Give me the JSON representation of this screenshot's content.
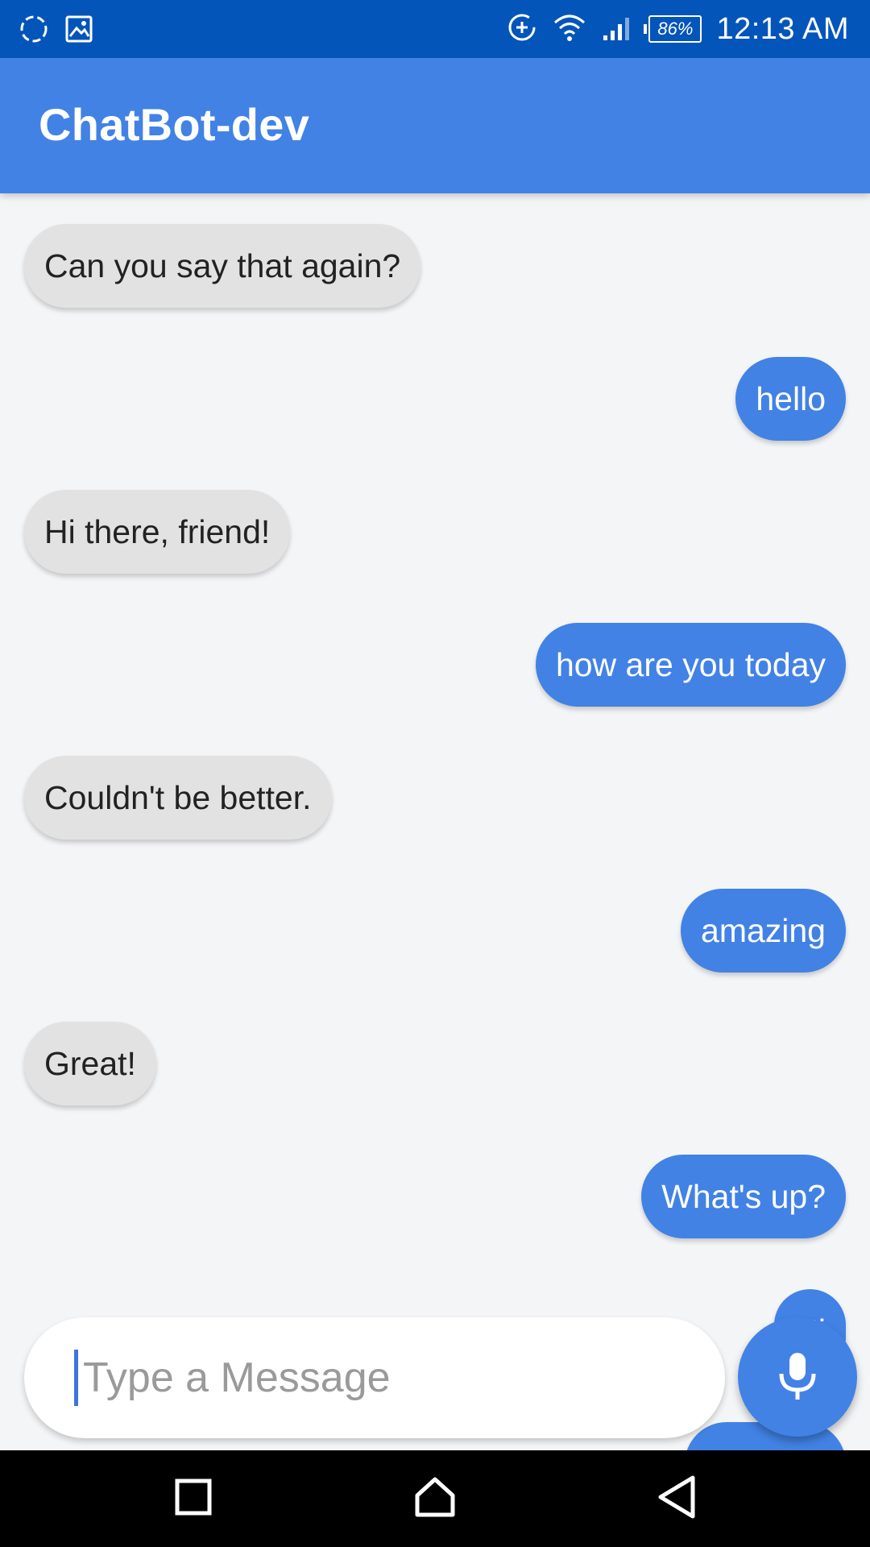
{
  "status_bar": {
    "time": "12:13 AM",
    "battery": "86%",
    "icons": [
      "sync-icon",
      "image-icon",
      "data-saver-icon",
      "wifi-icon",
      "signal-icon",
      "battery-icon"
    ]
  },
  "app_bar": {
    "title": "ChatBot-dev"
  },
  "messages": [
    {
      "sender": "bot",
      "text": "Can you say that again?"
    },
    {
      "sender": "user",
      "text": "hello"
    },
    {
      "sender": "bot",
      "text": "Hi there, friend!"
    },
    {
      "sender": "user",
      "text": "how are you today"
    },
    {
      "sender": "bot",
      "text": "Couldn't be better."
    },
    {
      "sender": "user",
      "text": "amazing"
    },
    {
      "sender": "bot",
      "text": "Great!"
    },
    {
      "sender": "user",
      "text": "What's up?"
    },
    {
      "sender": "user",
      "text": "Hi"
    }
  ],
  "composer": {
    "placeholder": "Type a Message",
    "value": "",
    "mic_icon": "mic-icon"
  },
  "nav_bar": {
    "icons": [
      "recents-icon",
      "home-icon",
      "back-icon"
    ]
  },
  "colors": {
    "status_bar": "#0455ba",
    "accent": "#4282e5",
    "bot_bubble": "#e2e2e2",
    "background": "#f4f5f7"
  }
}
